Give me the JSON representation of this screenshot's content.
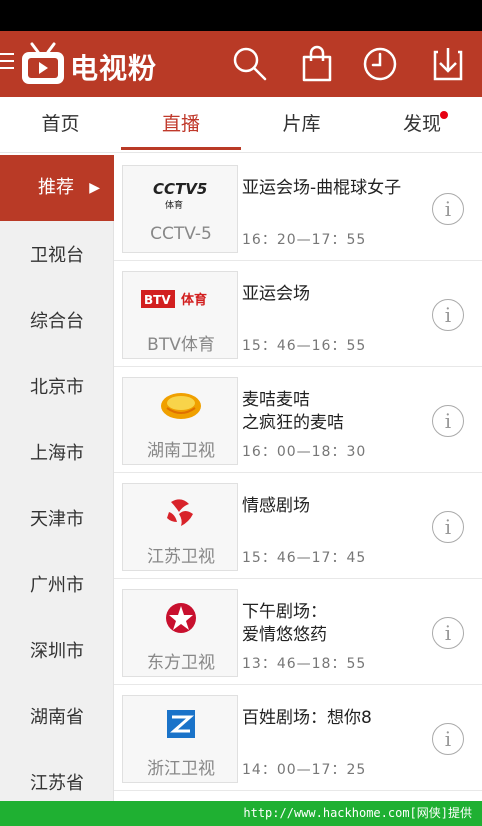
{
  "app": {
    "title": "电视粉",
    "colors": {
      "brand": "#b93a26",
      "accent_text": "#c0392b",
      "badge": "#e60012",
      "footer": "#1fb032"
    }
  },
  "toolbar": {
    "actions": [
      "search-icon",
      "bag-icon",
      "history-clock-icon",
      "download-icon"
    ]
  },
  "tabs": [
    {
      "label": "首页"
    },
    {
      "label": "直播",
      "active": true
    },
    {
      "label": "片库"
    },
    {
      "label": "发现",
      "badge": true
    }
  ],
  "sidebar": {
    "items": [
      {
        "label": "推荐",
        "active": true,
        "arrow": "▶"
      },
      {
        "label": "卫视台"
      },
      {
        "label": "综合台"
      },
      {
        "label": "北京市"
      },
      {
        "label": "上海市"
      },
      {
        "label": "天津市"
      },
      {
        "label": "广州市"
      },
      {
        "label": "深圳市"
      },
      {
        "label": "湖南省"
      },
      {
        "label": "江苏省"
      }
    ]
  },
  "programs": [
    {
      "channel": "CCTV-5",
      "logo": "cctv5-logo",
      "title": "亚运会场-曲棍球女子",
      "time": "16：20—17：55"
    },
    {
      "channel": "BTV体育",
      "logo": "btv-sports-logo",
      "title": "亚运会场",
      "time": "15：46—16：55"
    },
    {
      "channel": "湖南卫视",
      "logo": "hunan-tv-logo",
      "title": "麦咭麦咭\n之疯狂的麦咭",
      "title_line1": "麦咭麦咭",
      "title_line2": "之疯狂的麦咭",
      "time": "16：00—18：30"
    },
    {
      "channel": "江苏卫视",
      "logo": "jiangsu-tv-logo",
      "title": "情感剧场",
      "time": "15：46—17：45"
    },
    {
      "channel": "东方卫视",
      "logo": "dragon-tv-logo",
      "title": "下午剧场：爱情悠悠药",
      "title_line1": "下午剧场：",
      "title_line2": "爱情悠悠药",
      "time": "13：46—18：55"
    },
    {
      "channel": "浙江卫视",
      "logo": "zhejiang-tv-logo",
      "title": "百姓剧场：想你8",
      "time": "14：00—17：25"
    }
  ],
  "logo_text": {
    "cctv5": "CCTV5",
    "cctv5_sub": "体育",
    "btv": "BTV",
    "btv_sub": "体育"
  },
  "footer": {
    "text": "http://www.hackhome.com[网侠]提供"
  }
}
